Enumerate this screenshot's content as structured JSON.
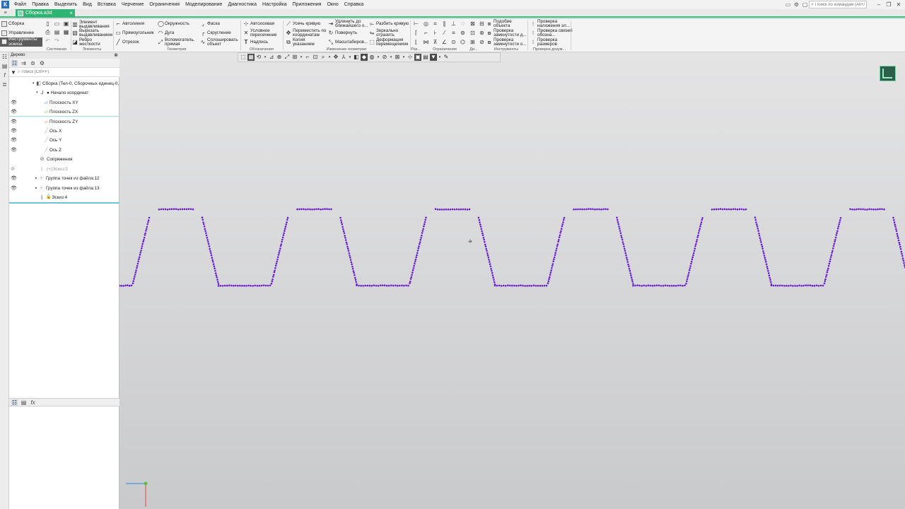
{
  "menubar": {
    "logo": "К",
    "items": [
      "Файл",
      "Правка",
      "Выделить",
      "Вид",
      "Вставка",
      "Черчение",
      "Ограничения",
      "Моделирование",
      "Диагностика",
      "Настройка",
      "Приложения",
      "Окно",
      "Справка"
    ],
    "search_placeholder": "Поиск по командам (Alt+/)"
  },
  "tab": {
    "title": "Сборка.a3d",
    "close": "×"
  },
  "ribbon": {
    "nav": [
      "Сборка",
      "Управление",
      "Инструменты эскиза"
    ],
    "system": {
      "label": "Системная"
    },
    "elements": {
      "label": "Элементы",
      "items": [
        "Элемент выдавливания",
        "Вырезать выдавливанием",
        "Ребро жесткости"
      ]
    },
    "geometry": {
      "label": "Геометрия",
      "items": [
        "Автолиния",
        "Окружность",
        "Фаска",
        "Прямоугольник",
        "Дуга",
        "Скругление",
        "Отрезок",
        "Вспомогатель. прямая",
        "Сплошировать объект"
      ]
    },
    "designations": {
      "label": "Обозначения",
      "items": [
        "Автоосевая",
        "Условное пересечение",
        "Надпись"
      ]
    },
    "edit_geometry": {
      "label": "Изменение геометрии",
      "items": [
        "Усечь кривую",
        "Удлинить до ближайшего о...",
        "Разбить кривую",
        "Переместить по координатам",
        "Повернуть",
        "Зеркально отразить",
        "Копия указанием",
        "Масштабиров...",
        "Деформация перемещением"
      ]
    },
    "small_groups": [
      "Раз...",
      "Ограничения",
      "Ди..."
    ],
    "tools": {
      "label": "Инструменты",
      "items": [
        "Подобие объекта",
        "Проверка замкнутости д...",
        "Проверка замкнутости о..."
      ]
    },
    "doc_check": {
      "label": "Проверка докум...",
      "items": [
        "Проверка наложения эл...",
        "Проверка связей обозна...",
        "Проверка размеров"
      ]
    }
  },
  "tree": {
    "title": "Дерево",
    "search_placeholder": "Поиск (Ctrl+F)",
    "nodes": [
      {
        "label": "Сборка (Тел-0, Сборочных единиц-0, Д"
      },
      {
        "label": "Начало координат"
      },
      {
        "label": "Плоскость XY"
      },
      {
        "label": "Плоскость ZX"
      },
      {
        "label": "Плоскость ZY"
      },
      {
        "label": "Ось X"
      },
      {
        "label": "Ось Y"
      },
      {
        "label": "Ось Z"
      },
      {
        "label": "Сопряжения"
      },
      {
        "label": "(+)Эскиз:2"
      },
      {
        "label": "Группа точек из файла:12"
      },
      {
        "label": "Группа точек из файла:13"
      },
      {
        "label": "Эскиз:4"
      }
    ]
  },
  "colors": {
    "accent": "#2fb573",
    "points": "#6a1fd0",
    "viewport_top": "#e4e4e5",
    "viewport_bottom": "#c9cacc"
  }
}
